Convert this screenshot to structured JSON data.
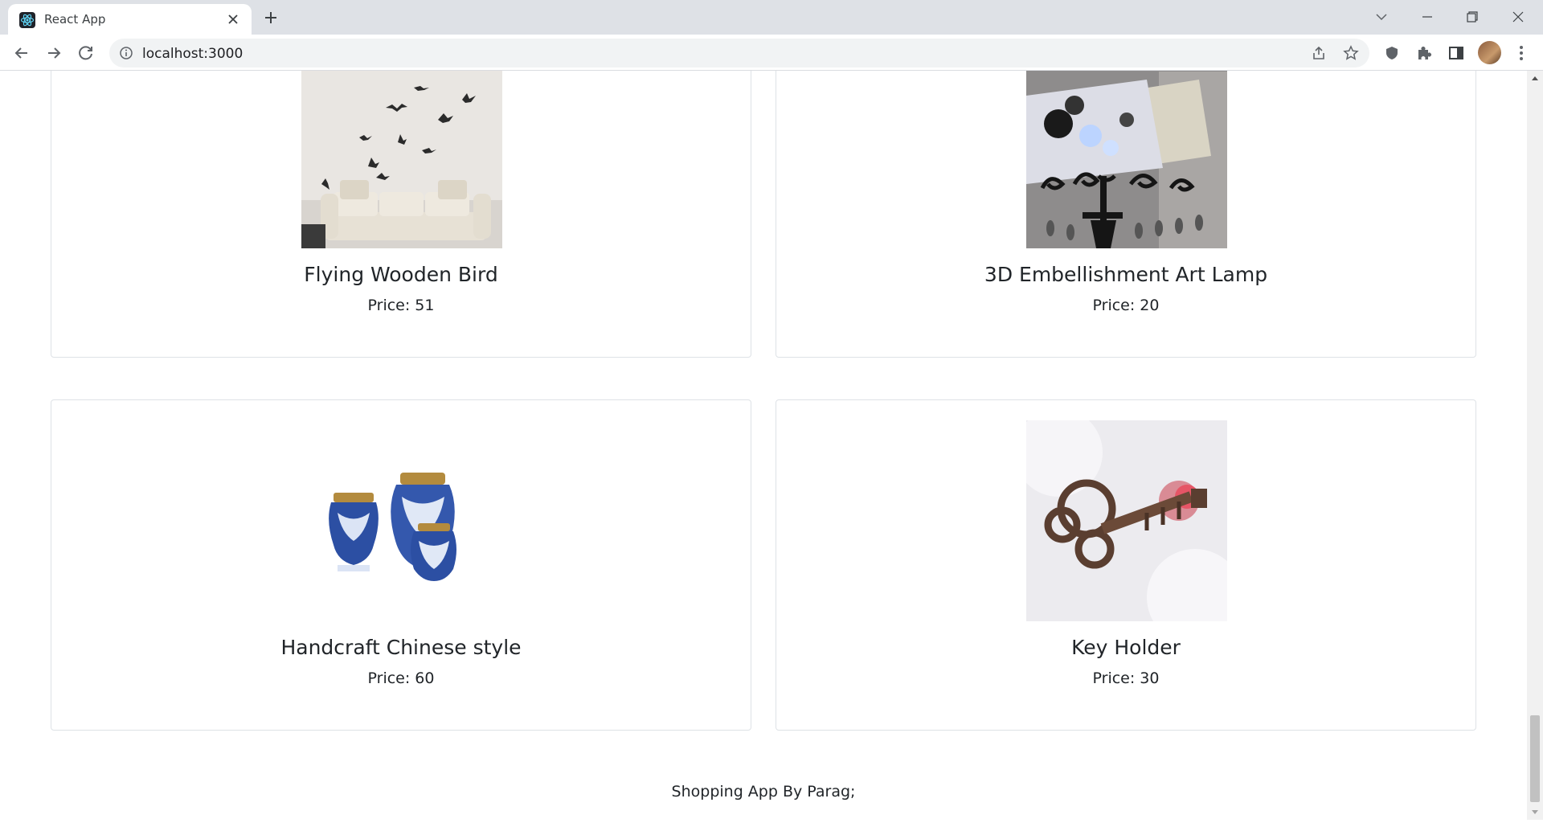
{
  "browser": {
    "tab_title": "React App",
    "url": "localhost:3000"
  },
  "products": [
    {
      "name": "Flying Wooden Bird",
      "price_label": "Price: 51"
    },
    {
      "name": "3D Embellishment Art Lamp",
      "price_label": "Price: 20"
    },
    {
      "name": "Handcraft Chinese style",
      "price_label": "Price: 60"
    },
    {
      "name": "Key Holder",
      "price_label": "Price: 30"
    }
  ],
  "footer": {
    "text": "Shopping App By Parag;"
  },
  "icons": {
    "favicon": "react-logo-icon",
    "tab_close": "close-icon",
    "new_tab": "plus-icon",
    "back": "back-arrow-icon",
    "forward": "forward-arrow-icon",
    "reload": "reload-icon",
    "site_info": "info-icon",
    "share": "share-icon",
    "bookmark": "star-icon",
    "shield": "shield-icon",
    "extensions": "puzzle-icon",
    "side_panel": "side-panel-icon",
    "menu": "kebab-menu-icon"
  },
  "colors": {
    "tabstrip_bg": "#dee1e6",
    "card_border": "#dee2e6",
    "text": "#212529"
  }
}
